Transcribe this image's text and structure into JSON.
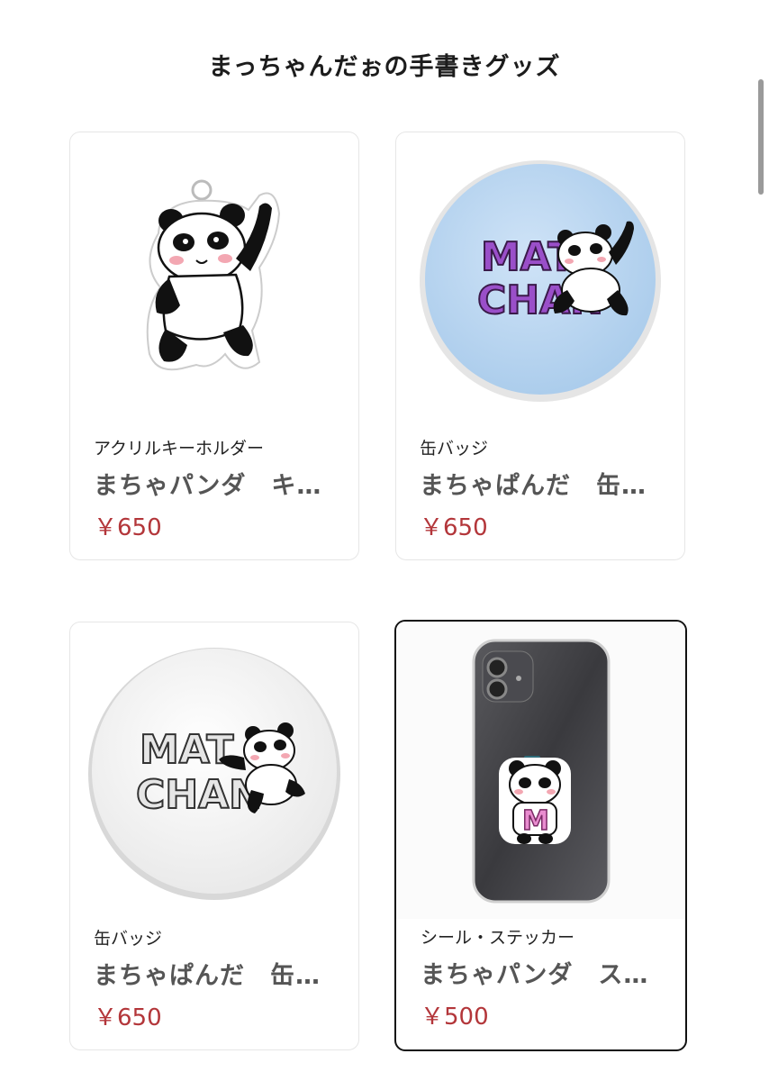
{
  "page": {
    "title": "まっちゃんだぉの手書きグッズ"
  },
  "products": [
    {
      "category": "アクリルキーホルダー",
      "name": "まちゃパンダ　キーホルダー",
      "price": "￥650",
      "image_icon": "panda-keychain-image"
    },
    {
      "category": "缶バッジ",
      "name": "まちゃぱんだ　缶バッジ",
      "price": "￥650",
      "image_icon": "blue-badge-image",
      "badge_text": [
        "MAT",
        "CHAN"
      ],
      "badge_color": "#b8d6f2",
      "text_color": "#9a4fc9"
    },
    {
      "category": "缶バッジ",
      "name": "まちゃぱんだ　缶バッジ",
      "price": "￥650",
      "image_icon": "white-badge-image",
      "badge_text": [
        "MAT",
        "CHAN"
      ],
      "badge_color": "#f4f4f4",
      "text_color": "#e6e6e6"
    },
    {
      "category": "シール・ステッカー",
      "name": "まちゃパンダ　ステッカー",
      "price": "￥500",
      "image_icon": "phone-sticker-image",
      "sticker_letter": "M"
    }
  ],
  "colors": {
    "price": "#b3363a",
    "selected_border": "#111111"
  }
}
